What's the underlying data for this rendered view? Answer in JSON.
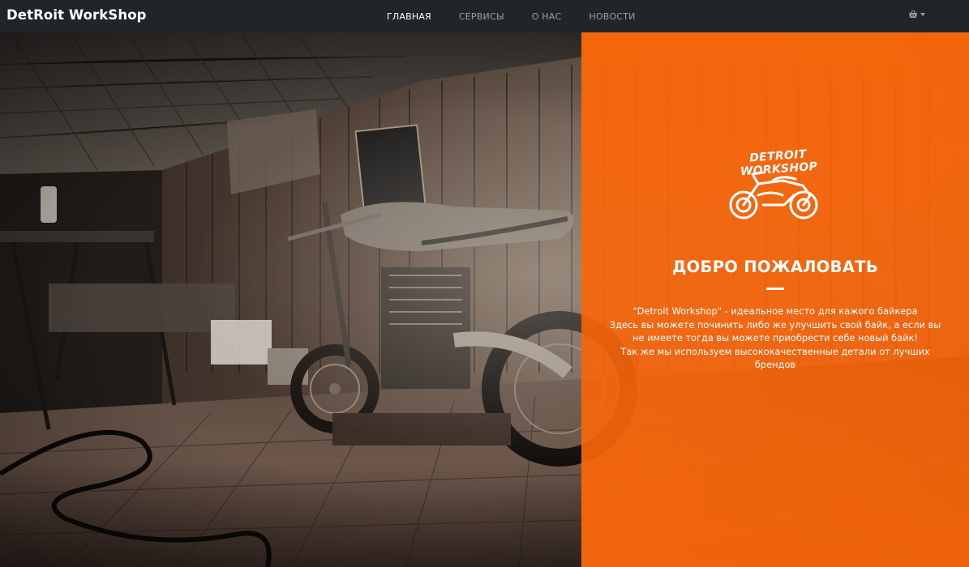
{
  "navbar": {
    "brand": "DetRoit WorkShop",
    "links": [
      {
        "label": "ГЛАВНАЯ",
        "active": true
      },
      {
        "label": "СЕРВИСЫ",
        "active": false
      },
      {
        "label": "О НАС",
        "active": false
      },
      {
        "label": "НОВОСТИ",
        "active": false
      }
    ],
    "cart_icon": "basket-icon"
  },
  "hero": {
    "logo_text": "DETROIT WORKSHOP",
    "title": "ДОБРО ПОЖАЛОВАТЬ",
    "description_lines": [
      "\"Detroit Workshop\" - идеальное место для кажого байкера",
      "Здесь вы можете починить либо же улучшить свой байк, а если вы",
      "не имеете тогда вы можете приобрести себе новый байк!",
      "Так же мы используем высококачественные детали от лучших",
      "брендов"
    ],
    "accent_color": "#ff6a08"
  }
}
